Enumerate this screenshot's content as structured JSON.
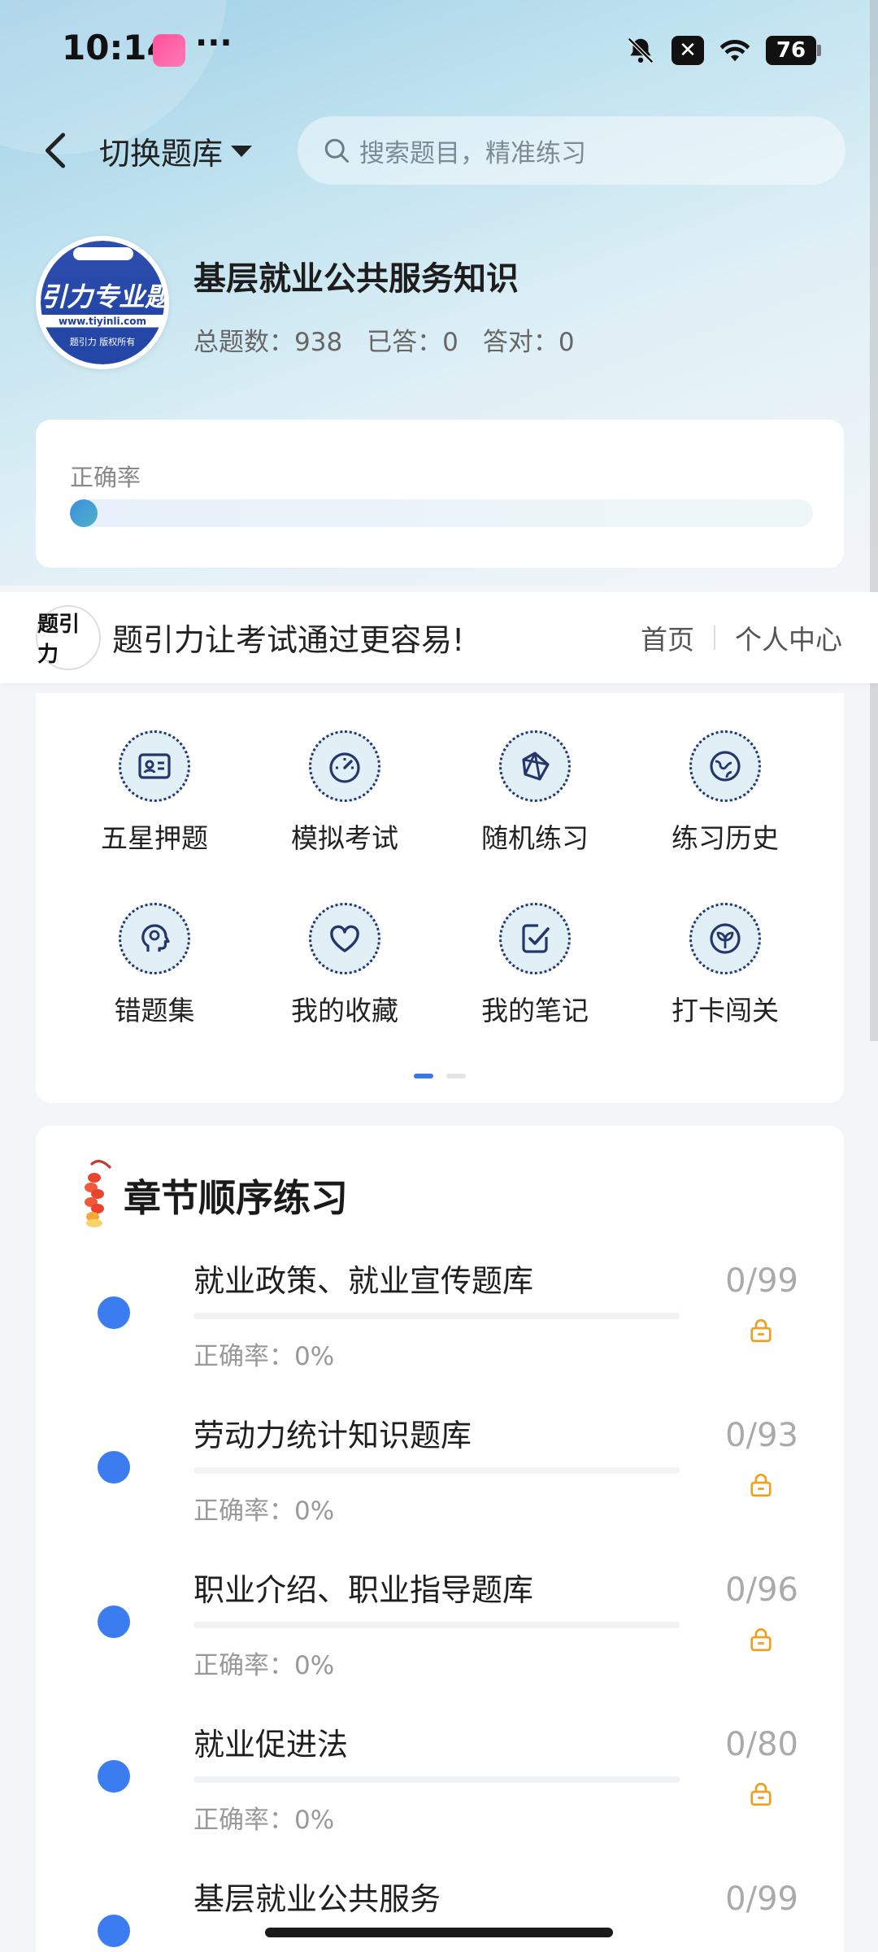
{
  "status_bar": {
    "time": "10:14",
    "dots": "···",
    "icons": [
      "bell-muted-icon",
      "close-box-icon",
      "wifi-icon",
      "battery-icon"
    ],
    "battery": "76"
  },
  "header": {
    "switch_label": "切换题库",
    "search_placeholder": "搜索题目，精准练习"
  },
  "bank": {
    "logo_text": "引力专业题",
    "logo_url": "www.tiyinli.com",
    "logo_copy": "题引力 版权所有",
    "title": "基层就业公共服务知识",
    "stats": {
      "total": "总题数：938",
      "answered": "已答：0",
      "correct": "答对：0"
    }
  },
  "accuracy": {
    "label": "正确率",
    "value": 0
  },
  "promo": {
    "logo_text": "题引力",
    "slogan": "题引力让考试通过更容易!",
    "nav_home": "首页",
    "nav_profile": "个人中心"
  },
  "features": [
    {
      "label": "五星押题",
      "icon": "id-card-icon"
    },
    {
      "label": "模拟考试",
      "icon": "speedometer-icon"
    },
    {
      "label": "随机练习",
      "icon": "network-icon"
    },
    {
      "label": "练习历史",
      "icon": "globe-icon"
    },
    {
      "label": "错题集",
      "icon": "head-icon"
    },
    {
      "label": "我的收藏",
      "icon": "heart-icon"
    },
    {
      "label": "我的笔记",
      "icon": "note-check-icon"
    },
    {
      "label": "打卡闯关",
      "icon": "sprout-icon"
    }
  ],
  "pager": {
    "pages": 2,
    "active": 0
  },
  "chapters": {
    "title": "章节顺序练习",
    "items": [
      {
        "name": "就业政策、就业宣传题库",
        "rate": "正确率：0%",
        "count": "0/99"
      },
      {
        "name": "劳动力统计知识题库",
        "rate": "正确率：0%",
        "count": "0/93"
      },
      {
        "name": "职业介绍、职业指导题库",
        "rate": "正确率：0%",
        "count": "0/96"
      },
      {
        "name": "就业促进法",
        "rate": "正确率：0%",
        "count": "0/80"
      },
      {
        "name": "基层就业公共服务",
        "rate": "",
        "count": "0/99"
      }
    ]
  },
  "colors": {
    "accent": "#3b7cf0",
    "lock": "#f0a020",
    "icon_stroke": "#24366c"
  }
}
